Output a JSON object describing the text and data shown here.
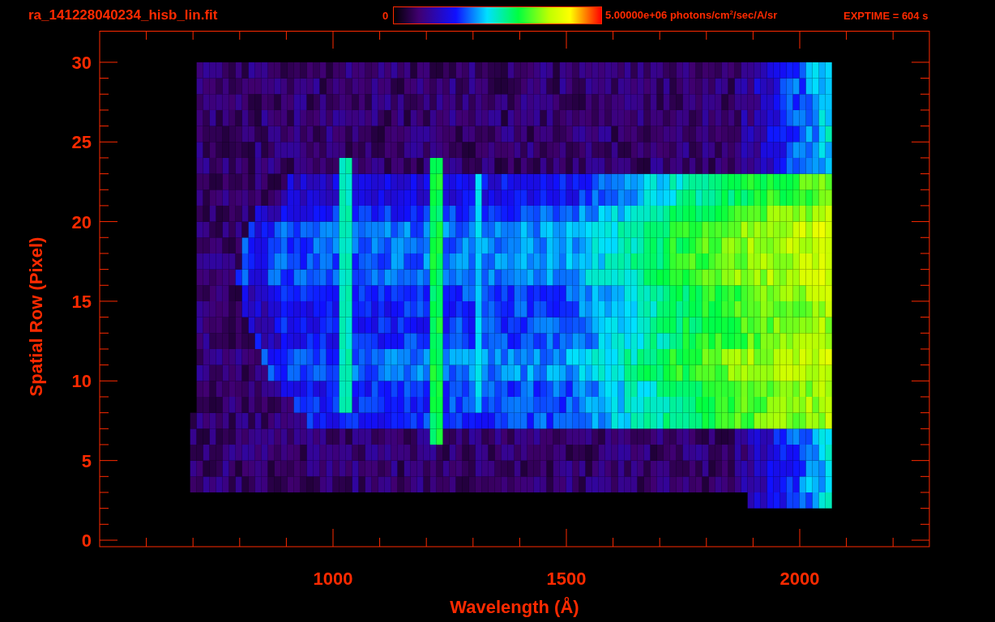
{
  "header": {
    "title": "ra_141228040234_hisb_lin.fit",
    "colorbar": {
      "min_label": "0",
      "max_label": "5.00000e+06 photons/cm$^{2}$/sec/A/sr"
    },
    "exposure": "EXPTIME = 604 s"
  },
  "plot": {
    "y_axis": {
      "title": "Spatial Row (Pixel)",
      "ticks": [
        "30",
        "25",
        "20",
        "15",
        "10",
        "5",
        "0"
      ]
    },
    "x_axis": {
      "title": "Wavelength (Å)",
      "ticks": [
        "1000",
        "1500",
        "2000"
      ]
    }
  }
}
